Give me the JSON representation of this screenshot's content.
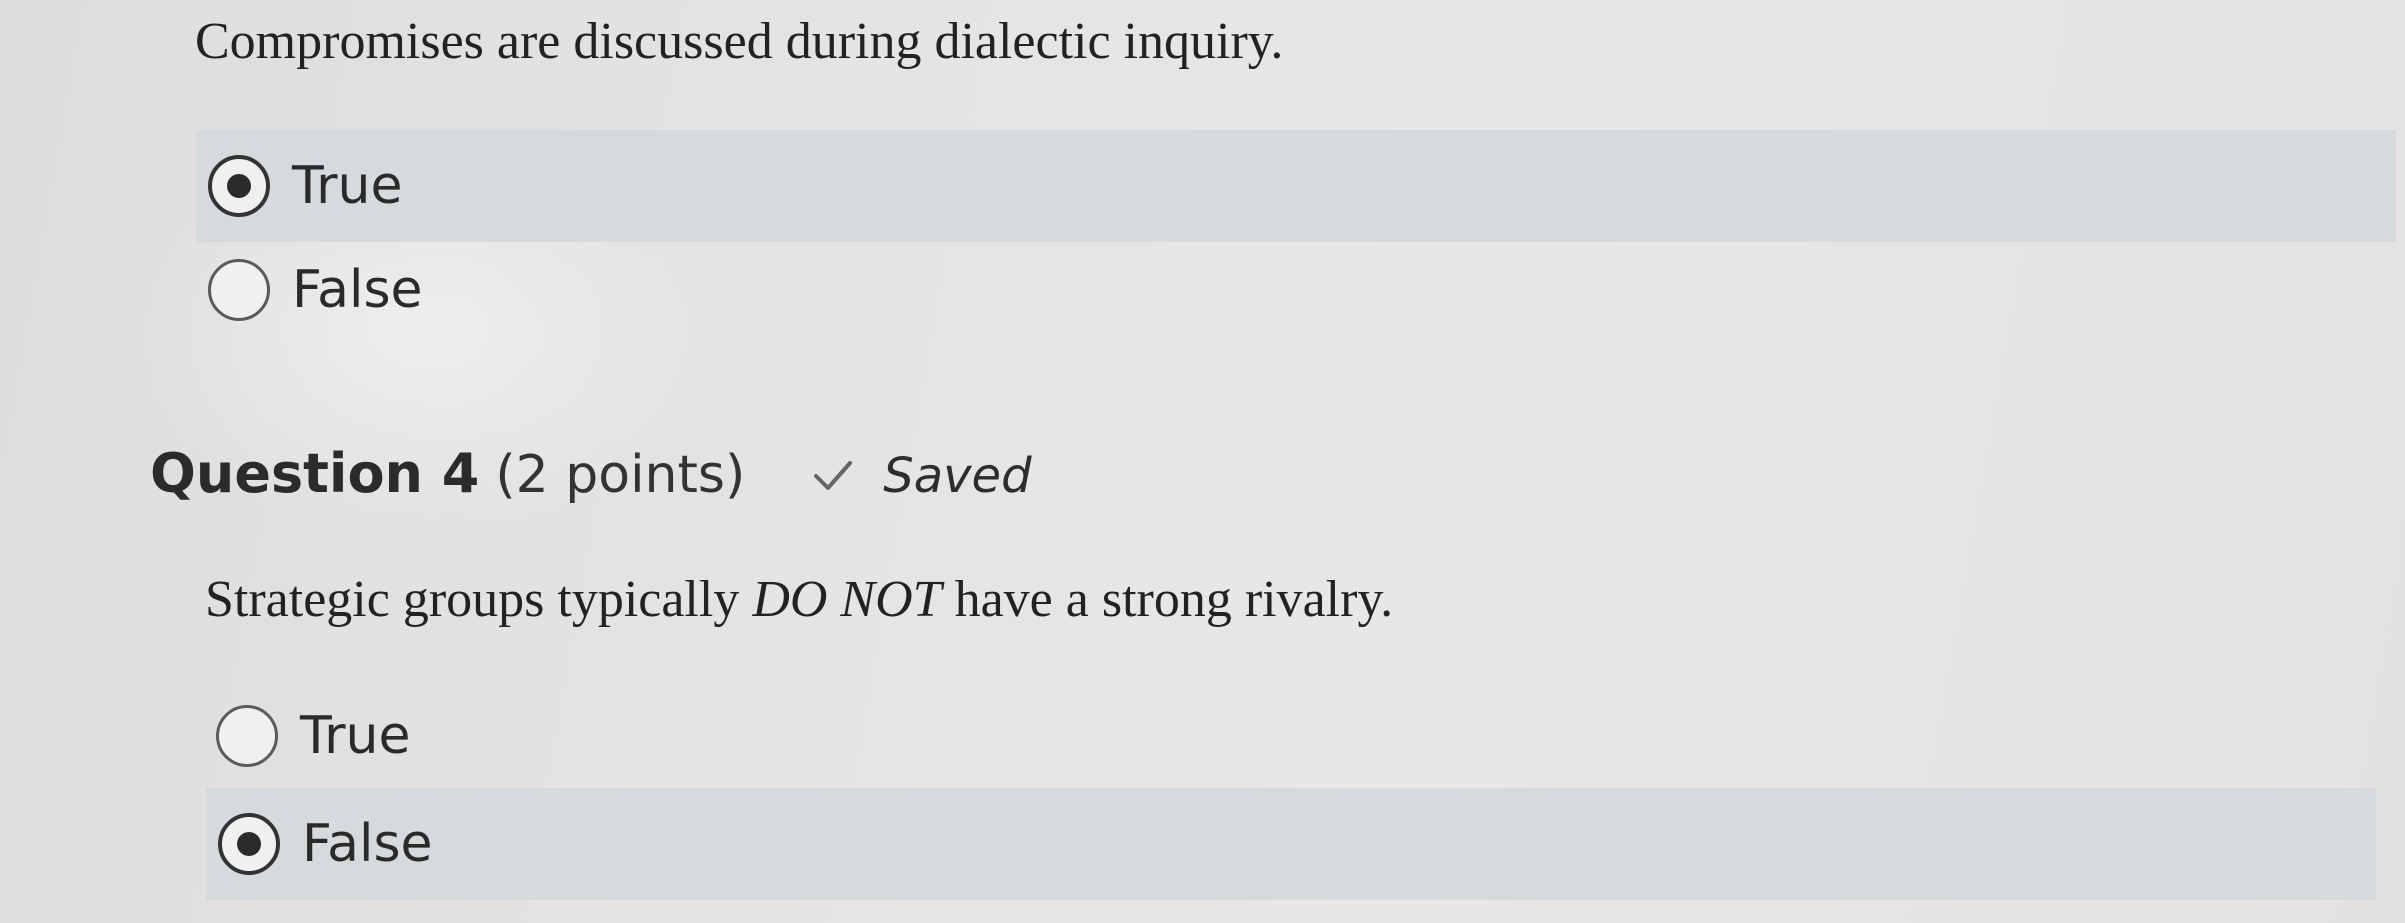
{
  "question3": {
    "text": "Compromises are discussed during dialectic inquiry.",
    "options": [
      {
        "label": "True",
        "selected": true
      },
      {
        "label": "False",
        "selected": false
      }
    ]
  },
  "question4": {
    "title": "Question 4",
    "points": "(2 points)",
    "status": "Saved",
    "status_icon": "checkmark-icon",
    "text_before": "Strategic groups typically ",
    "text_emphasis": "DO NOT",
    "text_after": " have a strong rivalry.",
    "options": [
      {
        "label": "True",
        "selected": false
      },
      {
        "label": "False",
        "selected": true
      }
    ]
  },
  "colors": {
    "selected_row_bg": "#d7dadd",
    "page_bg": "#e6e4e3"
  }
}
